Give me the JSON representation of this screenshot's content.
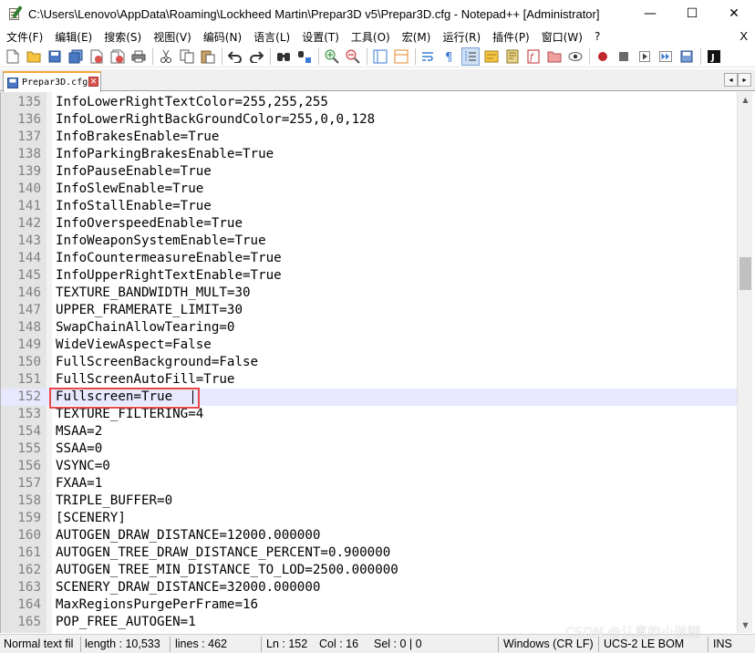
{
  "window": {
    "title": "C:\\Users\\Lenovo\\AppData\\Roaming\\Lockheed Martin\\Prepar3D v5\\Prepar3D.cfg - Notepad++ [Administrator]",
    "minimize_glyph": "—",
    "maximize_glyph": "☐",
    "close_glyph": "✕"
  },
  "menu": {
    "items": [
      "文件(F)",
      "编辑(E)",
      "搜索(S)",
      "视图(V)",
      "编码(N)",
      "语言(L)",
      "设置(T)",
      "工具(O)",
      "宏(M)",
      "运行(R)",
      "插件(P)",
      "窗口(W)",
      "?"
    ],
    "close_label": "X"
  },
  "toolbar": {
    "icons": [
      "new-file-icon",
      "open-file-icon",
      "save-icon",
      "save-all-icon",
      "close-file-icon",
      "close-all-icon",
      "print-icon",
      "cut-icon",
      "copy-icon",
      "paste-icon",
      "undo-icon",
      "redo-icon",
      "find-icon",
      "replace-icon",
      "zoom-in-icon",
      "zoom-out-icon",
      "sync-vertical-icon",
      "sync-horizontal-icon",
      "word-wrap-icon",
      "show-all-chars-icon",
      "indent-guide-icon",
      "udl-icon",
      "doc-map-icon",
      "function-list-icon",
      "folder-workspace-icon",
      "monitor-icon",
      "record-macro-icon",
      "stop-macro-icon",
      "play-macro-icon",
      "run-macro-multiple-icon",
      "save-macro-icon",
      "jslint-icon"
    ],
    "accent_record": "#c0282d",
    "accent_green": "#2e8b3a"
  },
  "tabs": [
    {
      "label": "Prepar3D.cfg",
      "close_glyph": "✕"
    }
  ],
  "tab_nav": {
    "left": "◂",
    "right": "▸"
  },
  "editor": {
    "current_line": 152,
    "lines": [
      {
        "n": "135",
        "text": "InfoLowerRightTextColor=255,255,255"
      },
      {
        "n": "136",
        "text": "InfoLowerRightBackGroundColor=255,0,0,128"
      },
      {
        "n": "137",
        "text": "InfoBrakesEnable=True"
      },
      {
        "n": "138",
        "text": "InfoParkingBrakesEnable=True"
      },
      {
        "n": "139",
        "text": "InfoPauseEnable=True"
      },
      {
        "n": "140",
        "text": "InfoSlewEnable=True"
      },
      {
        "n": "141",
        "text": "InfoStallEnable=True"
      },
      {
        "n": "142",
        "text": "InfoOverspeedEnable=True"
      },
      {
        "n": "143",
        "text": "InfoWeaponSystemEnable=True"
      },
      {
        "n": "144",
        "text": "InfoCountermeasureEnable=True"
      },
      {
        "n": "145",
        "text": "InfoUpperRightTextEnable=True"
      },
      {
        "n": "146",
        "text": "TEXTURE_BANDWIDTH_MULT=30"
      },
      {
        "n": "147",
        "text": "UPPER_FRAMERATE_LIMIT=30"
      },
      {
        "n": "148",
        "text": "SwapChainAllowTearing=0"
      },
      {
        "n": "149",
        "text": "WideViewAspect=False"
      },
      {
        "n": "150",
        "text": "FullScreenBackground=False"
      },
      {
        "n": "151",
        "text": "FullScreenAutoFill=True"
      },
      {
        "n": "152",
        "text": "Fullscreen=True"
      },
      {
        "n": "153",
        "text": "TEXTURE_FILTERING=4"
      },
      {
        "n": "154",
        "text": "MSAA=2"
      },
      {
        "n": "155",
        "text": "SSAA=0"
      },
      {
        "n": "156",
        "text": "VSYNC=0"
      },
      {
        "n": "157",
        "text": "FXAA=1"
      },
      {
        "n": "158",
        "text": "TRIPLE_BUFFER=0"
      },
      {
        "n": "159",
        "text": "[SCENERY]"
      },
      {
        "n": "160",
        "text": "AUTOGEN_DRAW_DISTANCE=12000.000000"
      },
      {
        "n": "161",
        "text": "AUTOGEN_TREE_DRAW_DISTANCE_PERCENT=0.900000"
      },
      {
        "n": "162",
        "text": "AUTOGEN_TREE_MIN_DISTANCE_TO_LOD=2500.000000"
      },
      {
        "n": "163",
        "text": "SCENERY_DRAW_DISTANCE=32000.000000"
      },
      {
        "n": "164",
        "text": "MaxRegionsPurgePerFrame=16"
      },
      {
        "n": "165",
        "text": "POP_FREE_AUTOGEN=1"
      }
    ],
    "highlight_color": "#e84a4a",
    "current_line_color": "#e8e8ff"
  },
  "scrollbar": {
    "up": "▲",
    "down": "▼"
  },
  "status": {
    "doc_type": "Normal text fil",
    "length": "length : 10,533",
    "lines": "lines : 462",
    "ln": "Ln : 152",
    "col": "Col : 16",
    "sel": "Sel : 0 | 0",
    "eol": "Windows (CR LF)",
    "encoding": "UCS-2 LE BOM",
    "mode": "INS"
  },
  "watermark": "CSDN @认真的小迷糊"
}
